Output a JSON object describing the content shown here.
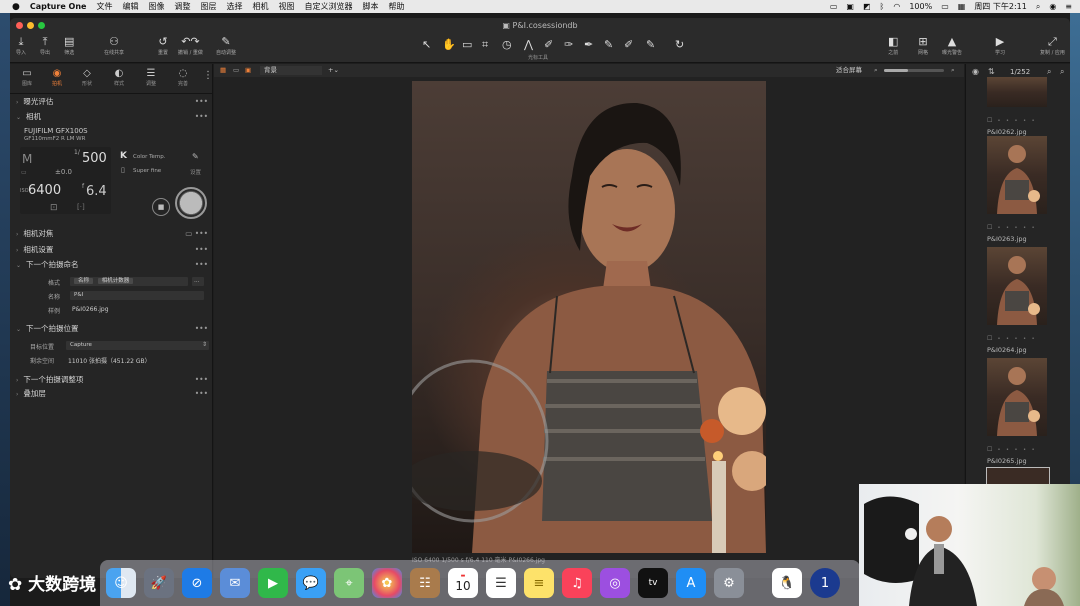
{
  "menubar": {
    "apple": "",
    "app": "Capture One",
    "items": [
      "文件",
      "编辑",
      "图像",
      "调整",
      "图层",
      "选择",
      "相机",
      "视图",
      "自定义浏览器",
      "脚本",
      "帮助"
    ],
    "battery": "100%",
    "clock": "周四 下午2:11"
  },
  "window": {
    "title": "P&I.cosessiondb"
  },
  "toolbar": {
    "left": [
      {
        "label": "导入",
        "icon": "import-icon"
      },
      {
        "label": "导出",
        "icon": "export-icon"
      },
      {
        "label": "筛选",
        "icon": "filter-icon"
      },
      {
        "label": "在线共享",
        "icon": "share-icon"
      },
      {
        "label": "重置",
        "icon": "reset-icon"
      },
      {
        "label": "撤销 / 重做",
        "icon": "undo-icon"
      },
      {
        "label": "自动调整",
        "icon": "auto-adjust-icon"
      }
    ],
    "cursor_tools_label": "光标工具",
    "right": [
      {
        "label": "之前",
        "icon": "before-icon"
      },
      {
        "label": "网格",
        "icon": "grid-icon"
      },
      {
        "label": "曝光警告",
        "icon": "exposure-warning-icon"
      },
      {
        "label": "学习",
        "icon": "learn-icon"
      },
      {
        "label": "复制 / 应用",
        "icon": "copy-apply-icon"
      }
    ]
  },
  "left_tabs": [
    {
      "label": "图库",
      "icon": "library-icon"
    },
    {
      "label": "拍机",
      "icon": "capture-icon"
    },
    {
      "label": "形状",
      "icon": "shape-icon"
    },
    {
      "label": "样式",
      "icon": "style-icon"
    },
    {
      "label": "调整",
      "icon": "adjust-icon"
    },
    {
      "label": "完善",
      "icon": "refine-icon"
    }
  ],
  "sections": {
    "exposure": "曝光评估",
    "camera": "相机",
    "camera_focus": "相机对焦",
    "camera_settings": "相机设置",
    "next_name": "下一个拍摄命名",
    "next_location": "下一个拍摄位置",
    "next_adjust": "下一个拍摄调整项",
    "overlay": "叠加层"
  },
  "camera": {
    "model": "FUJIFILM GFX100S",
    "lens": "GF110mmF2 R LM WR",
    "mode": "M",
    "shutter_prefix": "1/",
    "shutter": "500",
    "ev": "±0.0",
    "iso_prefix": "ISO",
    "iso": "6400",
    "aperture_prefix": "f",
    "aperture": "6.4",
    "wb_label": "Color Temp.",
    "quality_label": "Super fine",
    "settings_btn": "设置"
  },
  "naming": {
    "format_label": "格式",
    "format_tokens": [
      "名称",
      "相机计数器"
    ],
    "name_label": "名称",
    "name_value": "P&I",
    "sample_label": "样例",
    "sample_value": "P&I0266.jpg"
  },
  "location": {
    "target_label": "目标位置",
    "target_value": "Capture",
    "space_label": "剩余空间",
    "space_value": "11010 张拍摄（451.22 GB）"
  },
  "viewer": {
    "preset": "背景",
    "zoom": "适合屏幕",
    "caption": "ISO 6400    1/500 s    f/6.4    110 毫米           P&I0266.jpg"
  },
  "browser": {
    "count": "1/252",
    "thumbs": [
      "P&I0262.jpg",
      "P&I0263.jpg",
      "P&I0264.jpg",
      "P&I0265.jpg"
    ],
    "stars": "• • • • •"
  },
  "dock": [
    "finder-icon",
    "launchpad-icon",
    "safari-icon",
    "mail-icon",
    "facetime-icon",
    "messages-icon",
    "maps-icon",
    "photos-icon",
    "contacts-icon",
    "calendar-icon",
    "reminders-icon",
    "notes-icon",
    "music-icon",
    "podcasts-icon",
    "tv-icon",
    "appstore-icon",
    "settings-icon",
    "qq-icon",
    "1password-icon"
  ],
  "calendar_day": "10",
  "tv_label": "tv",
  "watermark": "大数跨境"
}
